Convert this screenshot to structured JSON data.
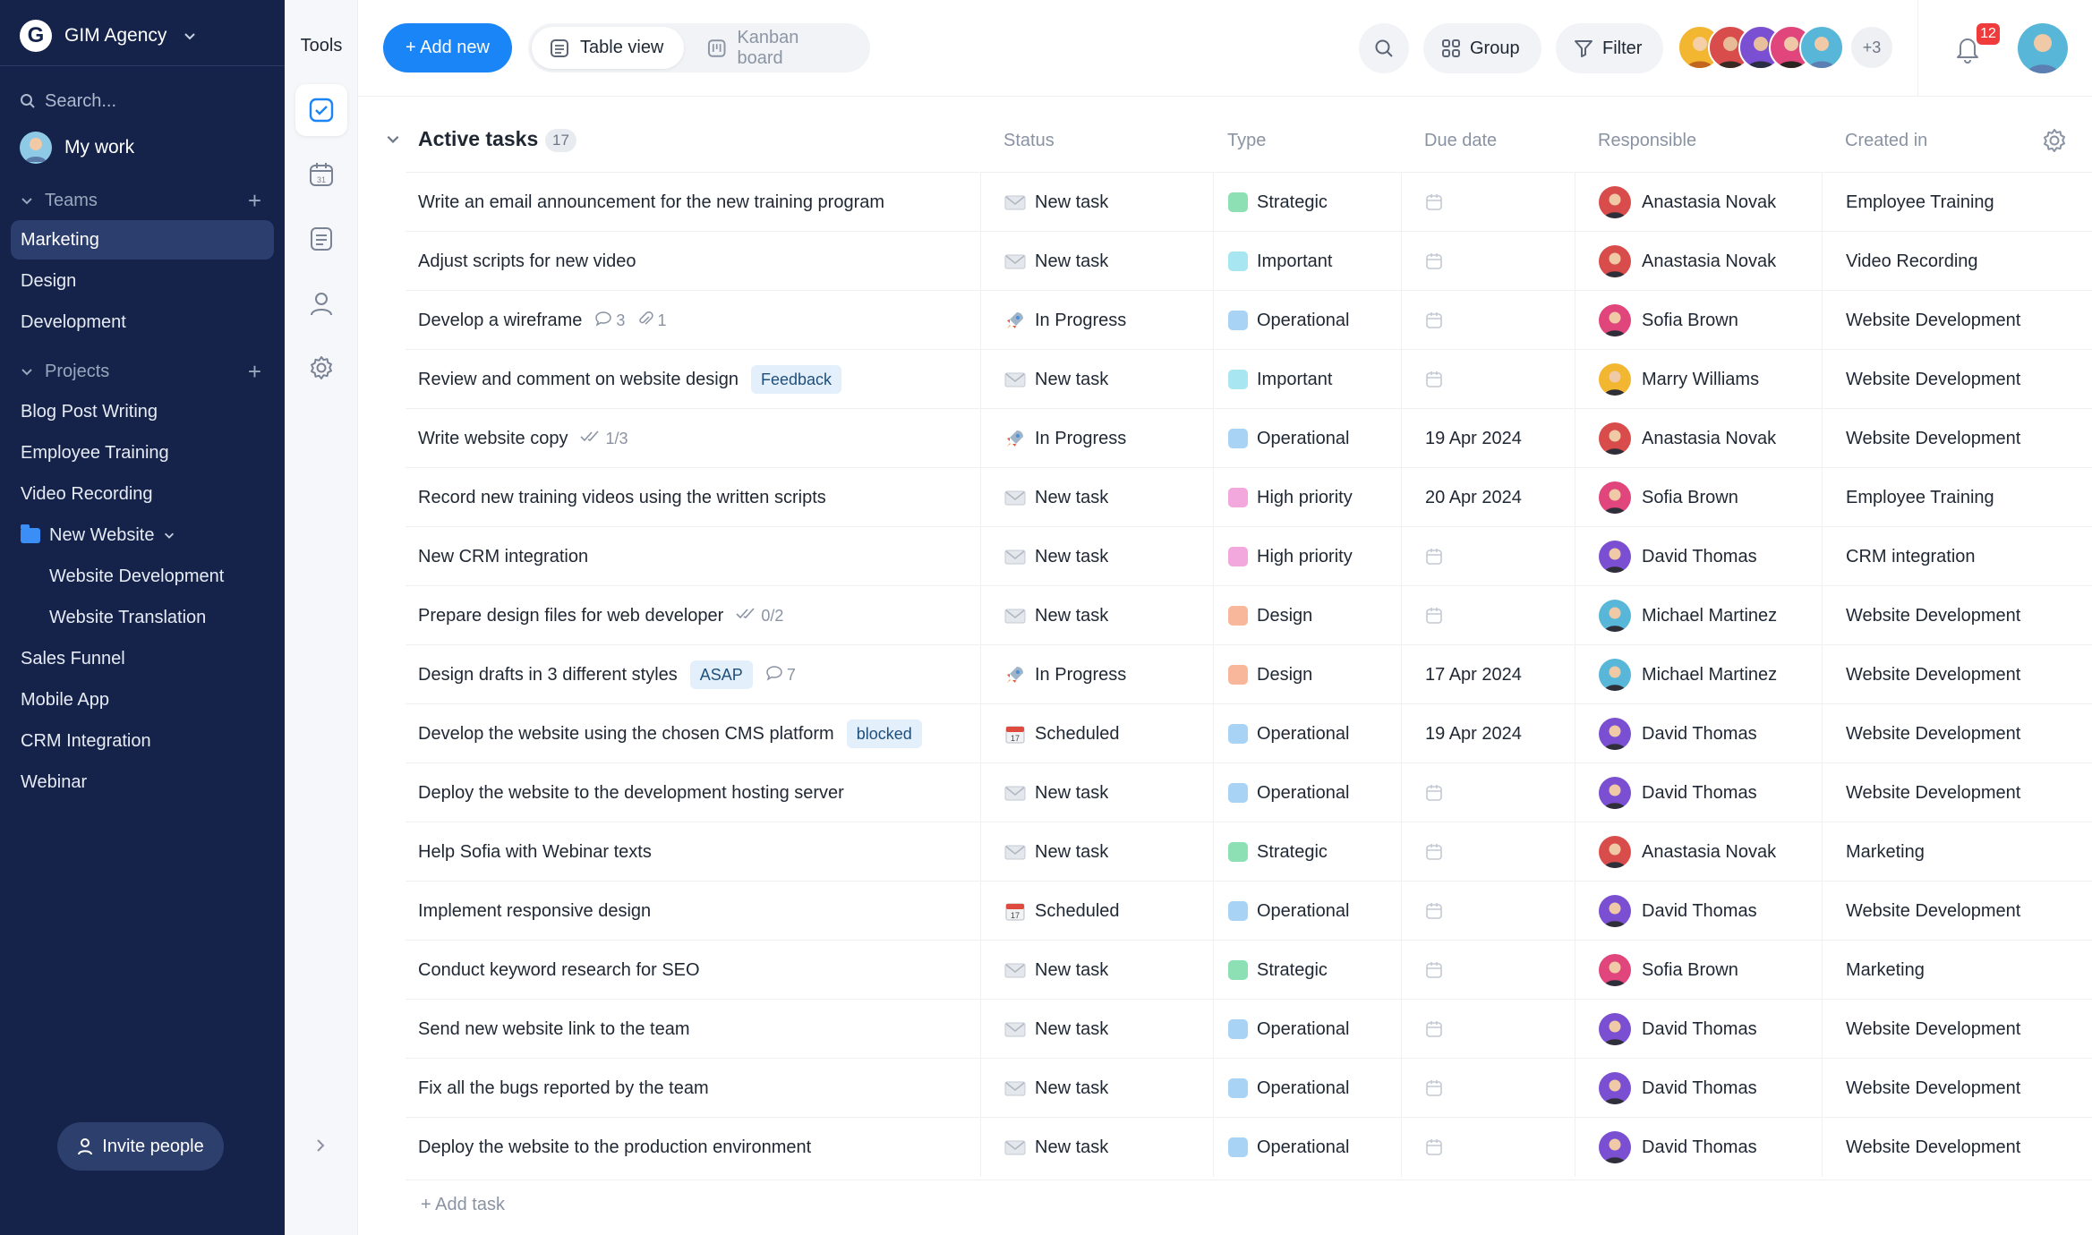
{
  "workspace": {
    "initial": "G",
    "name": "GIM Agency"
  },
  "sidebar": {
    "search_placeholder": "Search...",
    "my_work": "My work",
    "teams_label": "Teams",
    "teams": [
      "Marketing",
      "Design",
      "Development"
    ],
    "projects_label": "Projects",
    "projects": [
      "Blog Post Writing",
      "Employee Training",
      "Video Recording",
      "New Website",
      "Website Development",
      "Website Translation",
      "Sales Funnel",
      "Mobile App",
      "CRM Integration",
      "Webinar"
    ],
    "invite": "Invite people"
  },
  "tools": {
    "title": "Tools"
  },
  "toolbar": {
    "add_new": "+ Add new",
    "table_view": "Table view",
    "kanban_board": "Kanban board",
    "group": "Group",
    "filter": "Filter",
    "more_members": "+3",
    "notifications": "12"
  },
  "group": {
    "title": "Active tasks",
    "count": "17",
    "add_task": "+ Add task"
  },
  "columns": {
    "status": "Status",
    "type": "Type",
    "due": "Due date",
    "responsible": "Responsible",
    "created": "Created in"
  },
  "colors": {
    "accent": "#1a85f6",
    "sidebar": "#15234a",
    "strategic": "#8de0b3",
    "important": "#a8e6f2",
    "operational": "#a9d3f5",
    "high_priority": "#f2a7dd",
    "design": "#f8b79a"
  },
  "tasks": [
    {
      "name": "Write an email announcement for the new training program",
      "tag": "",
      "comments": "",
      "files": "",
      "checks": "",
      "status": "New task",
      "status_icon": "envelope-icon",
      "type": "Strategic",
      "type_color": "#8de0b3",
      "due": "",
      "person": "Anastasia Novak",
      "avatar_color": "#d94c4c",
      "created": "Employee Training"
    },
    {
      "name": "Adjust scripts for new video",
      "tag": "",
      "comments": "",
      "files": "",
      "checks": "",
      "status": "New task",
      "status_icon": "envelope-icon",
      "type": "Important",
      "type_color": "#a8e6f2",
      "due": "",
      "person": "Anastasia Novak",
      "avatar_color": "#d94c4c",
      "created": "Video Recording"
    },
    {
      "name": "Develop a wireframe",
      "tag": "",
      "comments": "3",
      "files": "1",
      "checks": "",
      "status": "In Progress",
      "status_icon": "rocket-icon",
      "type": "Operational",
      "type_color": "#a9d3f5",
      "due": "",
      "person": "Sofia Brown",
      "avatar_color": "#e0457b",
      "created": "Website Development"
    },
    {
      "name": "Review and comment on website design",
      "tag": "Feedback",
      "comments": "",
      "files": "",
      "checks": "",
      "status": "New task",
      "status_icon": "envelope-icon",
      "type": "Important",
      "type_color": "#a8e6f2",
      "due": "",
      "person": "Marry Williams",
      "avatar_color": "#f2b630",
      "created": "Website Development"
    },
    {
      "name": "Write website copy",
      "tag": "",
      "comments": "",
      "files": "",
      "checks": "1/3",
      "status": "In Progress",
      "status_icon": "rocket-icon",
      "type": "Operational",
      "type_color": "#a9d3f5",
      "due": "19 Apr 2024",
      "person": "Anastasia Novak",
      "avatar_color": "#d94c4c",
      "created": "Website Development"
    },
    {
      "name": "Record new training videos using the written scripts",
      "tag": "",
      "comments": "",
      "files": "",
      "checks": "",
      "status": "New task",
      "status_icon": "envelope-icon",
      "type": "High priority",
      "type_color": "#f2a7dd",
      "due": "20 Apr 2024",
      "person": "Sofia Brown",
      "avatar_color": "#e0457b",
      "created": "Employee Training"
    },
    {
      "name": "New CRM integration",
      "tag": "",
      "comments": "",
      "files": "",
      "checks": "",
      "status": "New task",
      "status_icon": "envelope-icon",
      "type": "High priority",
      "type_color": "#f2a7dd",
      "due": "",
      "person": "David Thomas",
      "avatar_color": "#7b4fd1",
      "created": "CRM integration"
    },
    {
      "name": "Prepare design files for web developer",
      "tag": "",
      "comments": "",
      "files": "",
      "checks": "0/2",
      "status": "New task",
      "status_icon": "envelope-icon",
      "type": "Design",
      "type_color": "#f8b79a",
      "due": "",
      "person": "Michael Martinez",
      "avatar_color": "#58b7d8",
      "created": "Website Development"
    },
    {
      "name": "Design drafts in 3 different styles",
      "tag": "ASAP",
      "comments": "7",
      "files": "",
      "checks": "",
      "status": "In Progress",
      "status_icon": "rocket-icon",
      "type": "Design",
      "type_color": "#f8b79a",
      "due": "17 Apr 2024",
      "person": "Michael Martinez",
      "avatar_color": "#58b7d8",
      "created": "Website Development"
    },
    {
      "name": "Develop the website using the chosen CMS platform",
      "tag": "blocked",
      "comments": "",
      "files": "",
      "checks": "",
      "status": "Scheduled",
      "status_icon": "calendar-icon",
      "type": "Operational",
      "type_color": "#a9d3f5",
      "due": "19 Apr 2024",
      "person": "David Thomas",
      "avatar_color": "#7b4fd1",
      "created": "Website Development"
    },
    {
      "name": "Deploy the website to the development hosting server",
      "tag": "",
      "comments": "",
      "files": "",
      "checks": "",
      "status": "New task",
      "status_icon": "envelope-icon",
      "type": "Operational",
      "type_color": "#a9d3f5",
      "due": "",
      "person": "David Thomas",
      "avatar_color": "#7b4fd1",
      "created": "Website Development"
    },
    {
      "name": "Help Sofia with Webinar texts",
      "tag": "",
      "comments": "",
      "files": "",
      "checks": "",
      "status": "New task",
      "status_icon": "envelope-icon",
      "type": "Strategic",
      "type_color": "#8de0b3",
      "due": "",
      "person": "Anastasia Novak",
      "avatar_color": "#d94c4c",
      "created": "Marketing"
    },
    {
      "name": "Implement responsive design",
      "tag": "",
      "comments": "",
      "files": "",
      "checks": "",
      "status": "Scheduled",
      "status_icon": "calendar-icon",
      "type": "Operational",
      "type_color": "#a9d3f5",
      "due": "",
      "person": "David Thomas",
      "avatar_color": "#7b4fd1",
      "created": "Website Development"
    },
    {
      "name": "Conduct keyword research for SEO",
      "tag": "",
      "comments": "",
      "files": "",
      "checks": "",
      "status": "New task",
      "status_icon": "envelope-icon",
      "type": "Strategic",
      "type_color": "#8de0b3",
      "due": "",
      "person": "Sofia Brown",
      "avatar_color": "#e0457b",
      "created": "Marketing"
    },
    {
      "name": "Send new website link to the team",
      "tag": "",
      "comments": "",
      "files": "",
      "checks": "",
      "status": "New task",
      "status_icon": "envelope-icon",
      "type": "Operational",
      "type_color": "#a9d3f5",
      "due": "",
      "person": "David Thomas",
      "avatar_color": "#7b4fd1",
      "created": "Website Development"
    },
    {
      "name": "Fix all the bugs reported by the team",
      "tag": "",
      "comments": "",
      "files": "",
      "checks": "",
      "status": "New task",
      "status_icon": "envelope-icon",
      "type": "Operational",
      "type_color": "#a9d3f5",
      "due": "",
      "person": "David Thomas",
      "avatar_color": "#7b4fd1",
      "created": "Website Development"
    },
    {
      "name": "Deploy the website to the production environment",
      "tag": "",
      "comments": "",
      "files": "",
      "checks": "",
      "status": "New task",
      "status_icon": "envelope-icon",
      "type": "Operational",
      "type_color": "#a9d3f5",
      "due": "",
      "person": "David Thomas",
      "avatar_color": "#7b4fd1",
      "created": "Website Development"
    }
  ]
}
